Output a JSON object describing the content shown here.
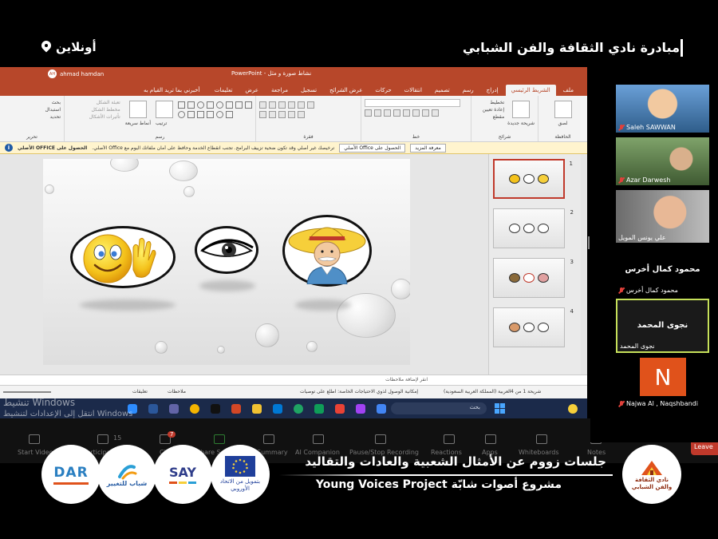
{
  "overlay": {
    "title": "مبادرة نادي الثقافة والفن الشبابي",
    "location": "أونلاين"
  },
  "powerpoint": {
    "app_name": "PowerPoint",
    "document_title": "نشاط صورة و مثل",
    "user_name": "ahmad hamdan",
    "user_initials": "AH",
    "tell_me": "أخبرني بما تريد القيام به",
    "tabs": [
      "ملف",
      "الشريط الرئيسي",
      "إدراج",
      "رسم",
      "تصميم",
      "انتقالات",
      "حركات",
      "عرض الشرائح",
      "تسجيل",
      "مراجعة",
      "عرض",
      "تعليمات"
    ],
    "ribbon_groups": [
      "الحافظة",
      "شرائح",
      "خط",
      "فقرة",
      "رسم",
      "تحرير"
    ],
    "ribbon_labels": {
      "paste": "لصق",
      "new_slide": "شريحة جديدة",
      "layout": "تخطيط",
      "reset": "إعادة تعيين",
      "section": "مقطع",
      "arrange": "ترتيب",
      "quick_styles": "أنماط سريعة",
      "shape_fill": "تعبئة الشكل",
      "shape_outline": "مخطط الشكل",
      "shape_effects": "تأثيرات الأشكال",
      "find": "بحث",
      "replace": "استبدال",
      "select": "تحديد"
    },
    "notice": {
      "label": "الحصول على OFFICE الأصلي",
      "message": "ترخيصك غير أصلي وقد تكون ضحية تزييف البرامج. تجنب انقطاع الخدمة وحافظ على أمان ملفاتك اليوم مع Office الأصلي.",
      "get_genuine_button": "الحصول على Office الأصلي",
      "learn_more_button": "معرفة المزيد"
    },
    "thumbnails": [
      "1",
      "2",
      "3",
      "4"
    ],
    "notes_placeholder": "انقر لإضافة ملاحظات",
    "status": {
      "slide_of": "شريحة 1 من 4",
      "language": "العربية (المملكة العربية السعودية)",
      "accessibility": "إمكانية الوصول لذوي الاحتياجات الخاصة: اطلع على توصيات",
      "notes_btn": "ملاحظات",
      "comments_btn": "تعليقات"
    },
    "taskbar_search": "بحث",
    "watermark_line1": "تنشيط Windows",
    "watermark_line2": "انتقل إلى الإعدادات لتنشيط Windows"
  },
  "zoom_toolbar": {
    "items": [
      "Start Video",
      "Participants",
      "Chat",
      "Share Screen",
      "Summary",
      "AI Companion",
      "Pause/Stop Recording",
      "Reactions",
      "Apps",
      "Whiteboards",
      "Notes"
    ],
    "participants_count": "15",
    "chat_badge": "7",
    "leave": "Leave"
  },
  "participants": [
    {
      "name": "Saleh SAWWAN",
      "muted": true
    },
    {
      "name": "Azar Darwesh",
      "muted": true
    },
    {
      "name": "علي يونس المويل",
      "muted": false
    },
    {
      "name": "محمود كمال أخرس",
      "display": "محمود كمال أخرس",
      "muted": true
    },
    {
      "name": "نجوى المحمد",
      "display": "نجوى المحمد",
      "muted": false
    },
    {
      "name": "Najwa Al , Naqshbandi",
      "initial": "N",
      "muted": true
    }
  ],
  "branding": {
    "line1": "جلسات زووم عن الأمثال الشعبية والعادات والتقاليد",
    "line2": "مشروع أصوات شابّة Young Voices Project",
    "logos": {
      "club": "نادي الثقافة والفن الشبابي",
      "eu_funded": "بتمويل من الاتحاد الأوروبي",
      "say": "SAY",
      "shabab": "شباب للتغيير",
      "dar": "DAR"
    }
  },
  "colors": {
    "ppt_red": "#b7472a",
    "active_speaker": "#c6e05a",
    "avatar_orange": "#e0521b",
    "leave_red": "#c0392b"
  }
}
